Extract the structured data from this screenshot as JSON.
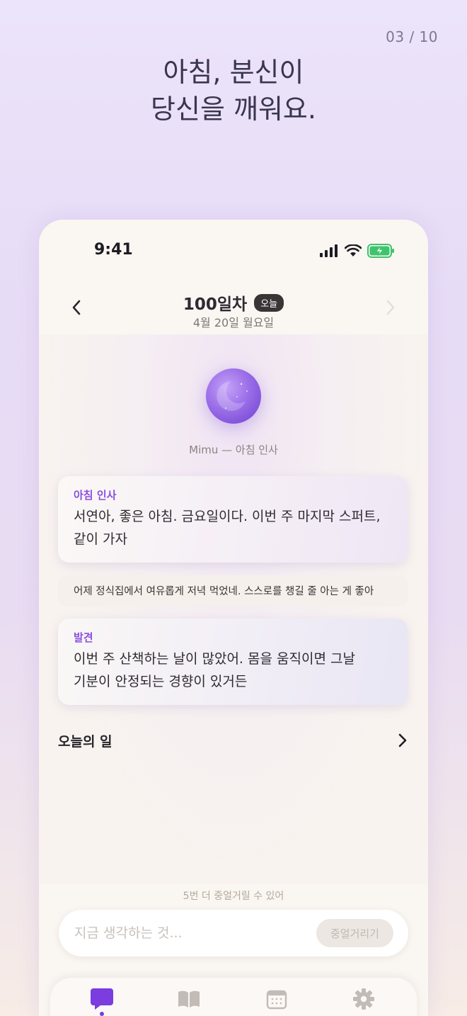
{
  "page_counter": "03 / 10",
  "headline": {
    "line1": "아침, 분신이",
    "line2": "당신을 깨워요."
  },
  "status_bar": {
    "time": "9:41"
  },
  "nav": {
    "title": "100일차",
    "badge": "오늘",
    "date": "4월 20일 월요일"
  },
  "companion": {
    "caption": "Mimu — 아침 인사"
  },
  "cards": [
    {
      "label": "아침 인사",
      "text_line1": "서연아, 좋은 아침. 금요일이다. 이번 주 마지막 스퍼트,",
      "text_line2": "같이 가자"
    },
    {
      "label": "발견",
      "text_line1": "이번 주 산책하는 날이 많았어. 몸을 움직이면 그날",
      "text_line2": "기분이 안정되는 경향이 있거든"
    }
  ],
  "note": "어제 정식집에서 여유롭게 저녁 먹었네. 스스로를 챙길 줄 아는 게 좋아",
  "todo": {
    "title": "오늘의 일"
  },
  "composer": {
    "hint": "5번 더 중얼거릴 수 있어",
    "placeholder": "지금 생각하는 것...",
    "send_label": "중얼거리기"
  },
  "tabs": [
    {
      "icon": "chat-bubble-icon",
      "active": true
    },
    {
      "icon": "book-icon",
      "active": false
    },
    {
      "icon": "calendar-icon",
      "active": false
    },
    {
      "icon": "gear-icon",
      "active": false
    }
  ],
  "colors": {
    "accent": "#7b3ce0",
    "label_purple": "#8a4fe0",
    "battery_green": "#3ec46d"
  }
}
